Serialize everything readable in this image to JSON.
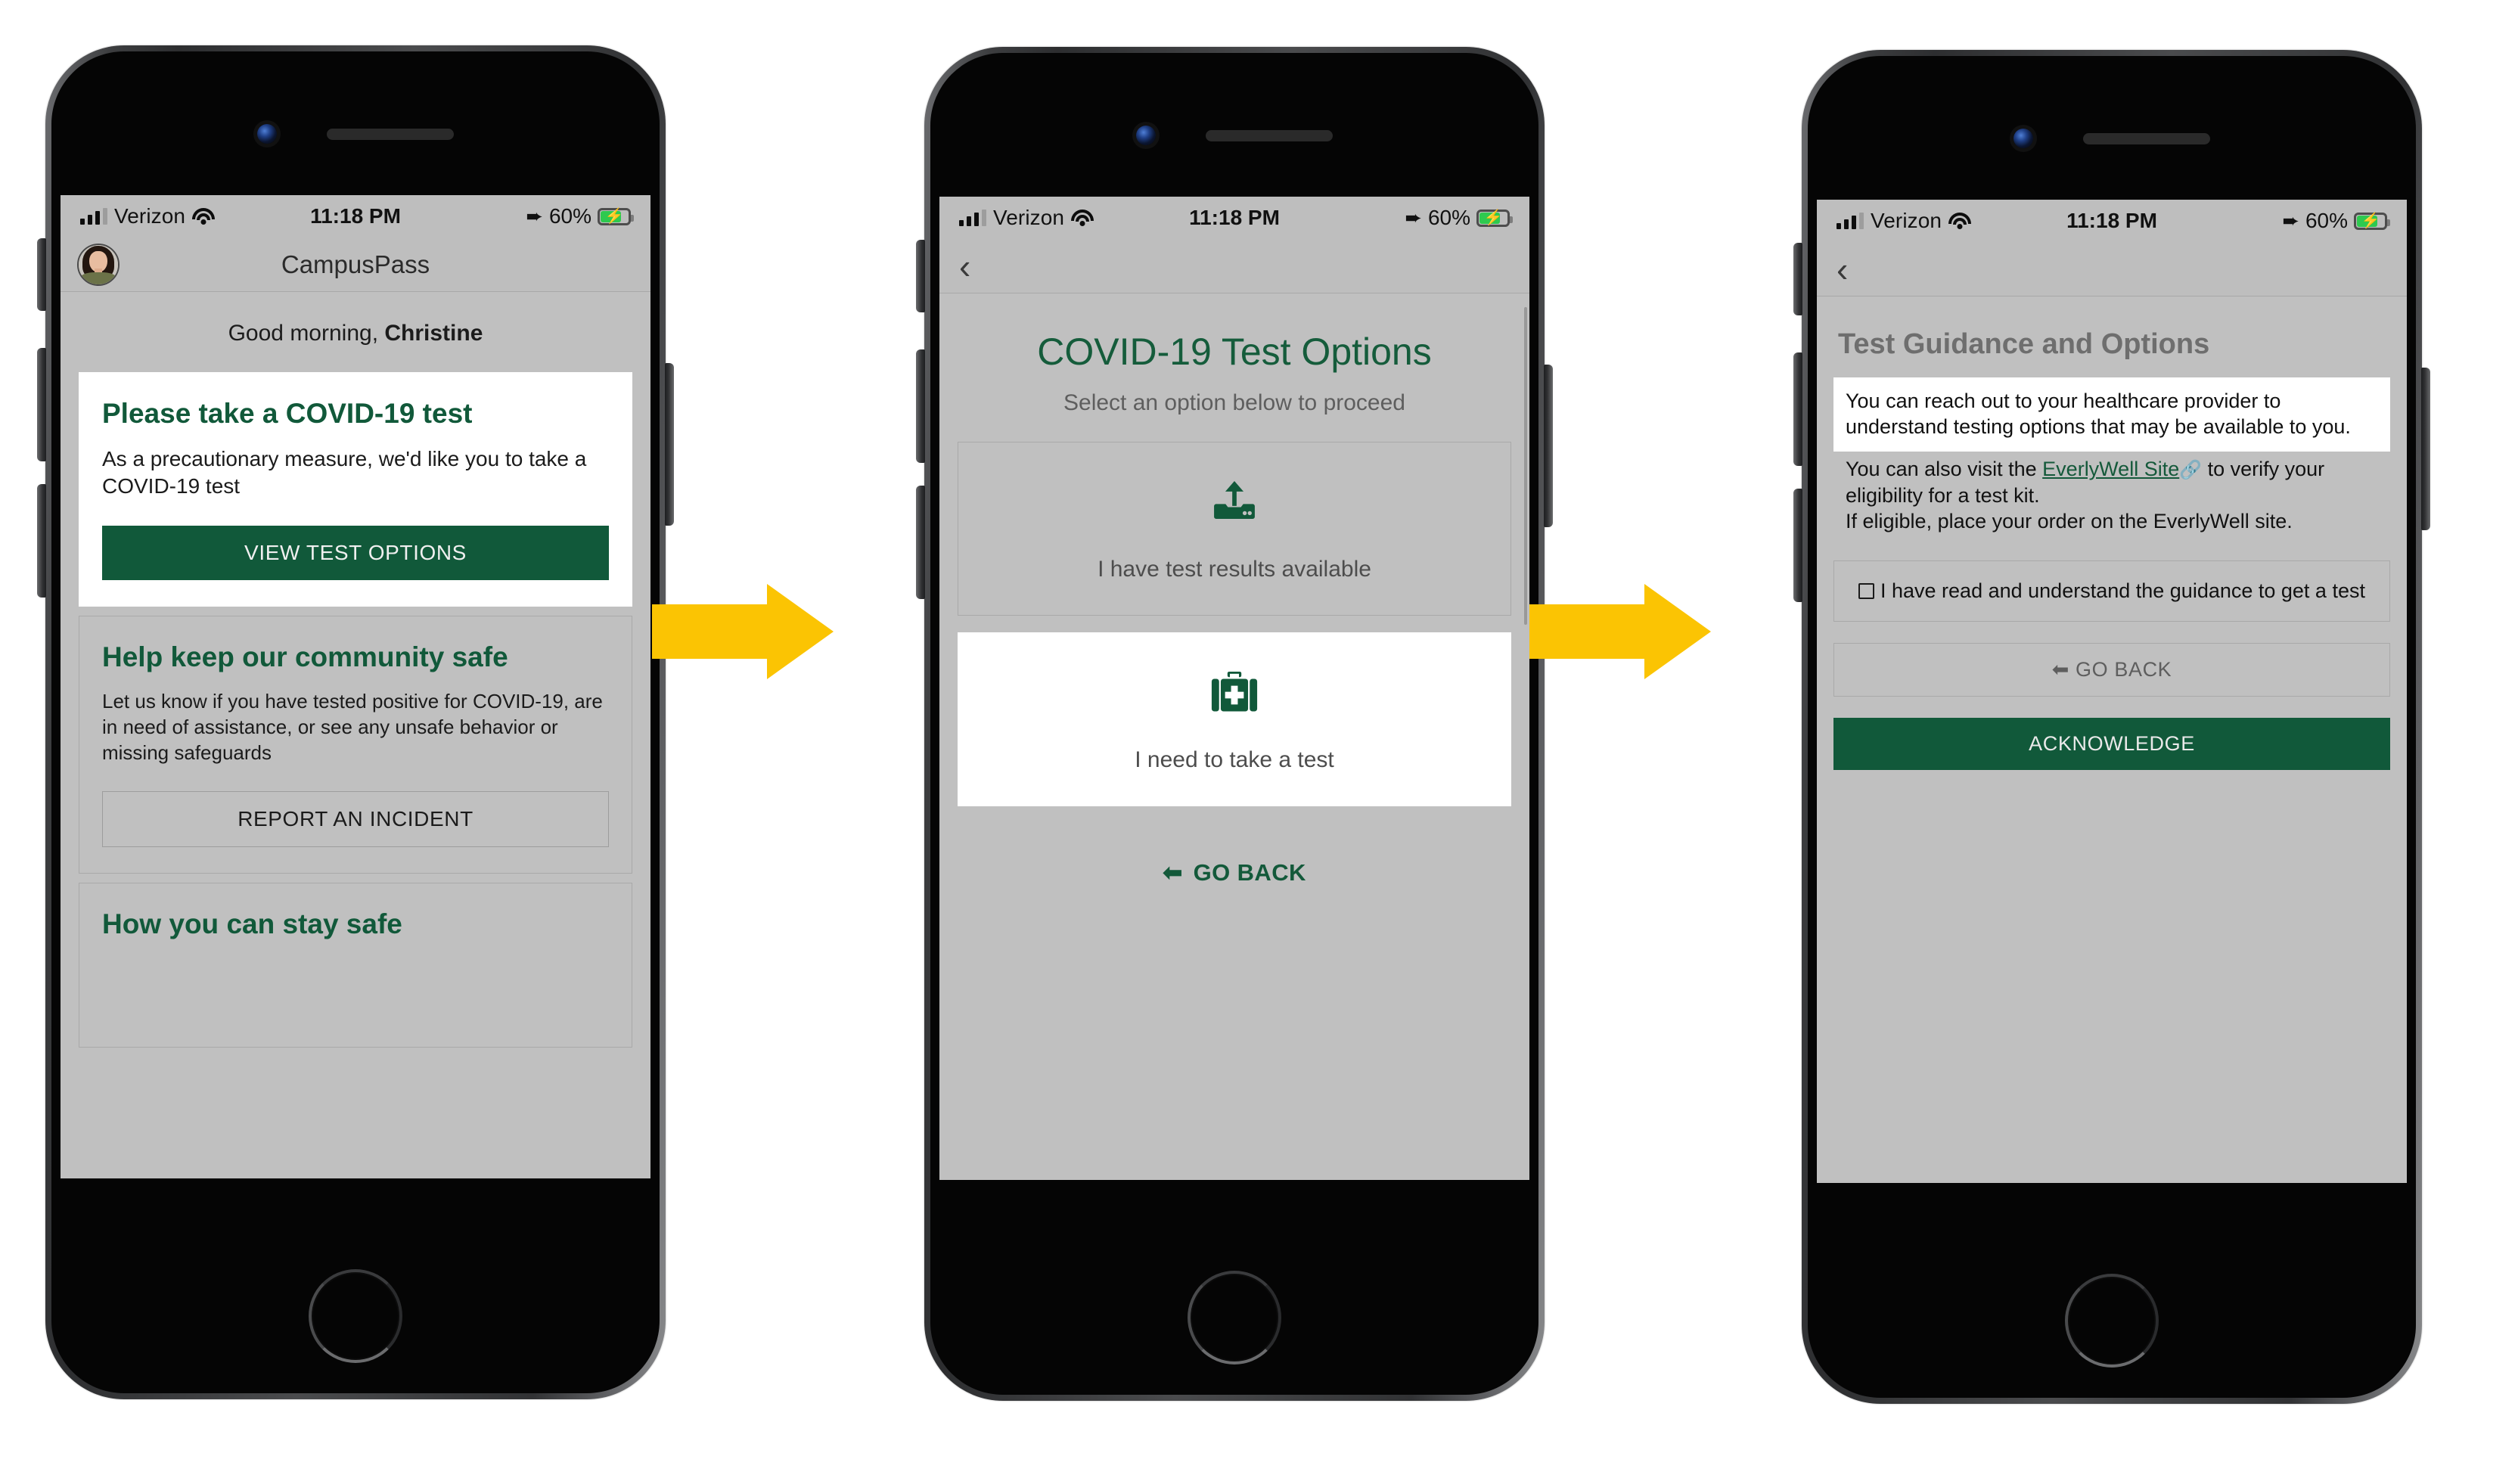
{
  "status_bar": {
    "carrier": "Verizon",
    "time": "11:18 PM",
    "battery_percent": "60%",
    "location_arrow": "location-arrow-icon",
    "wifi": "wifi-icon",
    "battery": "battery-charging-icon"
  },
  "colors": {
    "brand_green": "#11593A",
    "arrow_yellow": "#FBC403",
    "screen_bg": "#C0C0C0",
    "card_white": "#FFFFFF",
    "muted_text": "#5E5E5E"
  },
  "screen1": {
    "nav_title": "CampusPass",
    "avatar": "user-avatar",
    "greeting_prefix": "Good morning, ",
    "greeting_name": "Christine",
    "cards": [
      {
        "title": "Please take a COVID-19 test",
        "body": "As a precautionary measure, we'd like you to take a COVID-19 test",
        "button": "VIEW TEST OPTIONS"
      },
      {
        "title": "Help keep our community safe",
        "body": "Let us know if you have tested positive for COVID-19, are in need of assistance, or see any unsafe behavior or missing safeguards",
        "button": "REPORT AN INCIDENT"
      },
      {
        "title": "How you can stay safe"
      }
    ]
  },
  "screen2": {
    "back": "back-chevron-icon",
    "title": "COVID-19 Test Options",
    "subtitle": "Select an option below to proceed",
    "options": [
      {
        "icon": "upload-icon",
        "label": "I have test results available"
      },
      {
        "icon": "medical-kit-icon",
        "label": "I need to take a test"
      }
    ],
    "go_back": "GO BACK"
  },
  "screen3": {
    "back": "back-chevron-icon",
    "title": "Test Guidance and Options",
    "highlight": "You can reach out to your healthcare provider to understand testing options that may be available to you.",
    "para_before_link": "You can also visit the ",
    "link_text": "EverlyWell Site",
    "external_link_icon": "external-link-icon",
    "para_after_link": " to verify your eligibility for a test kit.",
    "para_line2": "If eligible, place your order on the EverlyWell site.",
    "checkbox_label": "I have read and understand the guidance to get a test",
    "go_back": "GO BACK",
    "acknowledge": "ACKNOWLEDGE"
  },
  "flow_arrows": [
    {
      "name": "flow-arrow-1"
    },
    {
      "name": "flow-arrow-2"
    }
  ]
}
